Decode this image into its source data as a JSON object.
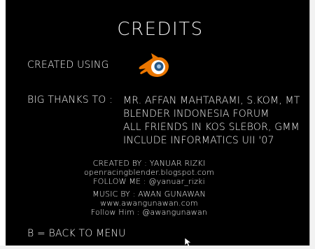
{
  "screen": {
    "title": "CREDITS",
    "created_using_label": "CREATED USING",
    "logo_icon": "blender-logo-icon",
    "big_thanks_label": "BIG THANKS TO :",
    "big_thanks": [
      "MR. AFFAN MAHTARAMI, S.KOM, MT",
      "BLENDER INDONESIA FORUM",
      "ALL FRIENDS IN KOS SLEBOR, GMM",
      "INCLUDE INFORMATICS UII '07"
    ],
    "created_by": "CREATED BY : YANUAR RIZKI",
    "created_by_site": "openracingblender.blogspot.com",
    "follow_me": "FOLLOW ME : @yanuar_rizki",
    "music_by": "MUSIC BY : AWAN GUNAWAN",
    "music_site": "www.awangunawan.com",
    "follow_him": "Follow Him : @awangunawan",
    "back_hint": "B = BACK TO MENU"
  },
  "colors": {
    "background": "#000000",
    "text": "#f2f2f2",
    "logo_orange": "#ea7600",
    "logo_blue": "#265787"
  }
}
